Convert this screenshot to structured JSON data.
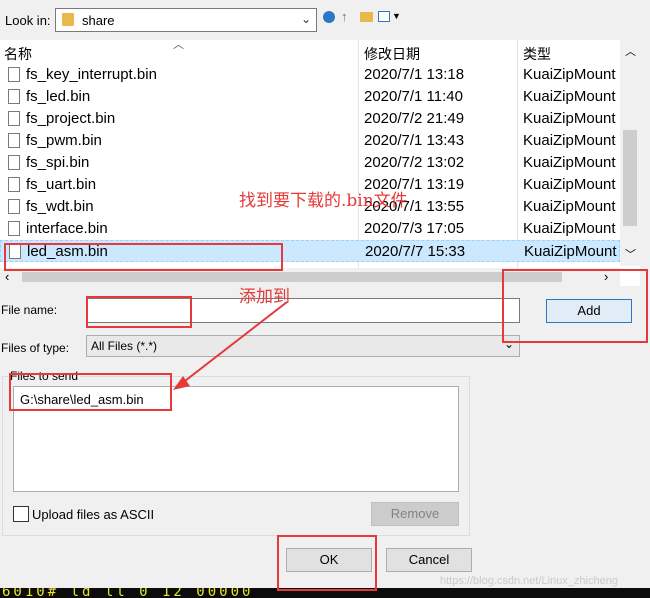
{
  "lookin": {
    "label": "Look in:",
    "value": "share"
  },
  "columns": {
    "name": "名称",
    "modified": "修改日期",
    "type": "类型"
  },
  "files": [
    {
      "name": "fs_key_interrupt.bin",
      "date": "2020/7/1 13:18",
      "type": "KuaiZipMount"
    },
    {
      "name": "fs_led.bin",
      "date": "2020/7/1 11:40",
      "type": "KuaiZipMount"
    },
    {
      "name": "fs_project.bin",
      "date": "2020/7/2 21:49",
      "type": "KuaiZipMount"
    },
    {
      "name": "fs_pwm.bin",
      "date": "2020/7/1 13:43",
      "type": "KuaiZipMount"
    },
    {
      "name": "fs_spi.bin",
      "date": "2020/7/2 13:02",
      "type": "KuaiZipMount"
    },
    {
      "name": "fs_uart.bin",
      "date": "2020/7/1 13:19",
      "type": "KuaiZipMount"
    },
    {
      "name": "fs_wdt.bin",
      "date": "2020/7/1 13:55",
      "type": "KuaiZipMount"
    },
    {
      "name": "interface.bin",
      "date": "2020/7/3 17:05",
      "type": "KuaiZipMount"
    },
    {
      "name": "led_asm.bin",
      "date": "2020/7/7 15:33",
      "type": "KuaiZipMount",
      "selected": true
    }
  ],
  "filename": {
    "label": "File name:",
    "value": ""
  },
  "filetype": {
    "label": "Files of type:",
    "value": "All Files (*.*)"
  },
  "buttons": {
    "add": "Add",
    "remove": "Remove",
    "ok": "OK",
    "cancel": "Cancel"
  },
  "send": {
    "label": "Files to send",
    "items": [
      "G:\\share\\led_asm.bin"
    ]
  },
  "ascii": {
    "label": "Upload files as ASCII",
    "checked": false
  },
  "annotations": {
    "find": "找到要下载的.bin文件",
    "add": "添加到"
  },
  "watermark": "https://blog.csdn.net/Linux_zhicheng",
  "terminal_text": "6010#  ld   ll  0  12  00000"
}
